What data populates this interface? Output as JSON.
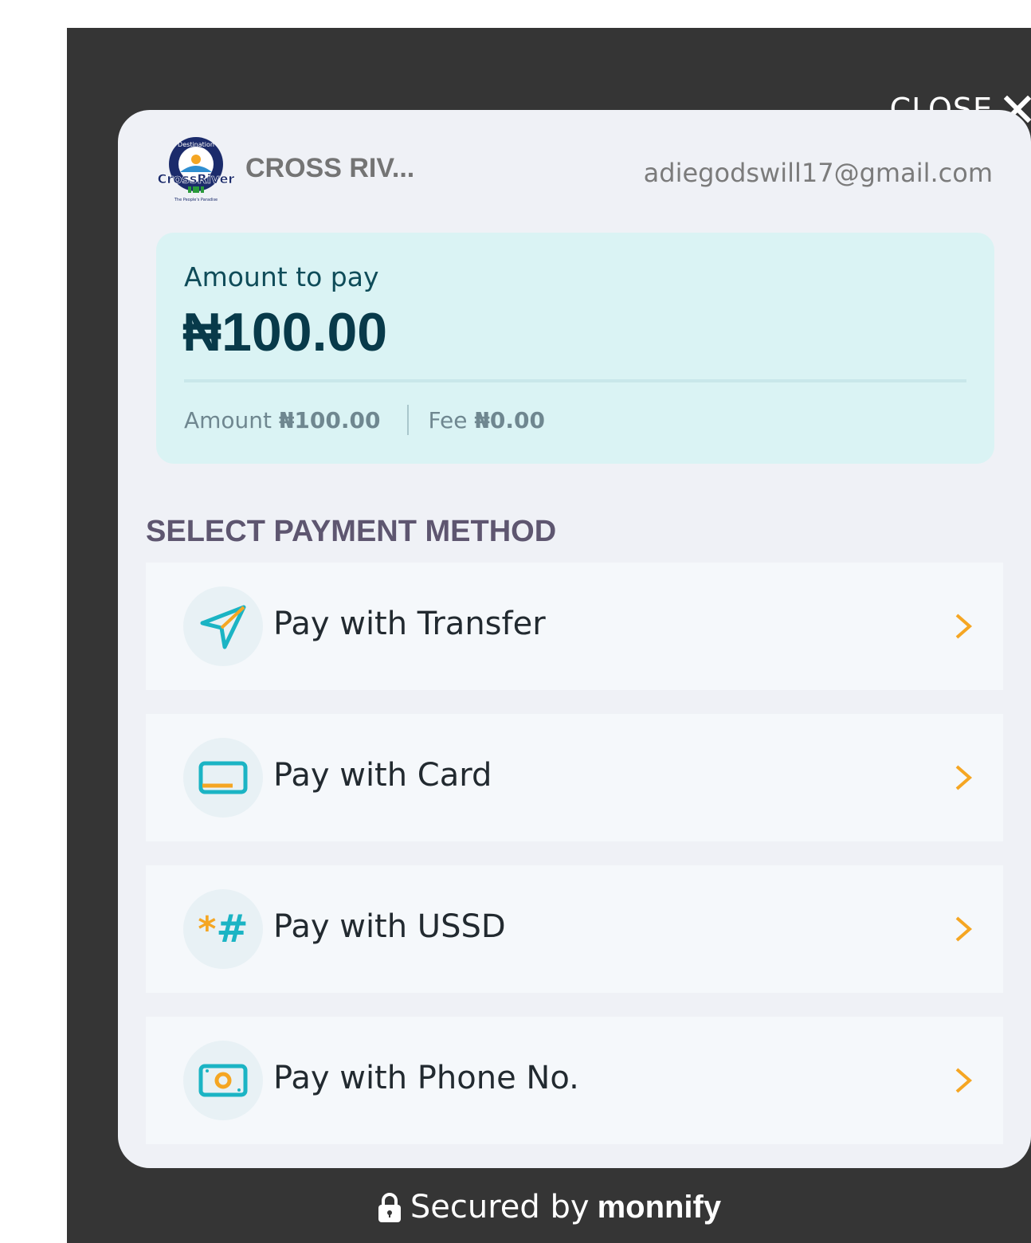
{
  "close": {
    "label": "CLOSE"
  },
  "header": {
    "merchant_name": "CROSS RIV...",
    "email": "adiegodswill17@gmail.com",
    "logo_top_text": "Destination",
    "logo_main_text": "CrossRiver",
    "logo_bottom_text": "The People's Paradise"
  },
  "amount": {
    "label": "Amount to pay",
    "total": "₦100.00",
    "breakdown_amount_label": "Amount",
    "breakdown_amount_value": "₦100.00",
    "breakdown_fee_label": "Fee",
    "breakdown_fee_value": "₦0.00"
  },
  "methods": {
    "title": "SELECT PAYMENT METHOD",
    "items": [
      {
        "label": "Pay with Transfer",
        "icon": "send-icon"
      },
      {
        "label": "Pay with Card",
        "icon": "card-icon"
      },
      {
        "label": "Pay with USSD",
        "icon": "ussd-icon",
        "icon_text_star": "*",
        "icon_text_hash": "#"
      },
      {
        "label": "Pay with Phone No.",
        "icon": "cash-icon"
      }
    ]
  },
  "footer": {
    "prefix": "Secured by",
    "brand": "monnify"
  },
  "colors": {
    "accent_teal": "#1bb4c4",
    "accent_orange": "#f5a623",
    "overlay": "#353535"
  }
}
